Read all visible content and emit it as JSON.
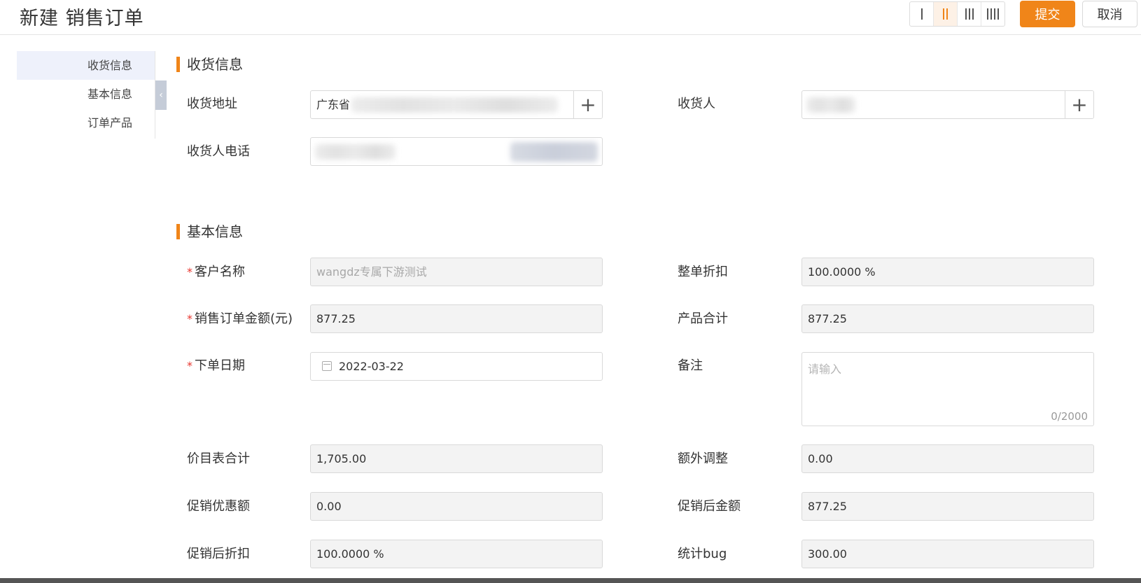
{
  "page": {
    "title": "新建 销售订单"
  },
  "toolbar": {
    "submit_label": "提交",
    "cancel_label": "取消",
    "column_options": [
      "1",
      "2",
      "3",
      "4"
    ],
    "selected_columns": "2"
  },
  "nav": {
    "items": [
      {
        "label": "收货信息",
        "active": true
      },
      {
        "label": "基本信息",
        "active": false
      },
      {
        "label": "订单产品",
        "active": false
      }
    ]
  },
  "sections": {
    "shipping": {
      "title": "收货信息",
      "address_label": "收货地址",
      "address_value": "广东省",
      "receiver_label": "收货人",
      "phone_label": "收货人电话"
    },
    "basic": {
      "title": "基本信息",
      "customer_label": "客户名称",
      "customer_value": "wangdz专属下游测试",
      "discount_label": "整单折扣",
      "discount_value": "100.0000 %",
      "amount_label": "销售订单金额(元)",
      "amount_value": "877.25",
      "product_total_label": "产品合计",
      "product_total_value": "877.25",
      "date_label": "下单日期",
      "date_value": "2022-03-22",
      "remark_label": "备注",
      "remark_placeholder": "请输入",
      "remark_counter": "0/2000",
      "pricelist_total_label": "价目表合计",
      "pricelist_total_value": "1,705.00",
      "extra_adjust_label": "额外调整",
      "extra_adjust_value": "0.00",
      "promo_discount_label": "促销优惠额",
      "promo_discount_value": "0.00",
      "promo_amount_label": "促销后金额",
      "promo_amount_value": "877.25",
      "promo_rate_label": "促销后折扣",
      "promo_rate_value": "100.0000 %",
      "stat_bug_label": "统计bug",
      "stat_bug_value": "300.00"
    }
  },
  "required_mark": "*",
  "colors": {
    "accent": "#f08519",
    "required": "#e8352e",
    "nav_active": "#eef1fb"
  }
}
